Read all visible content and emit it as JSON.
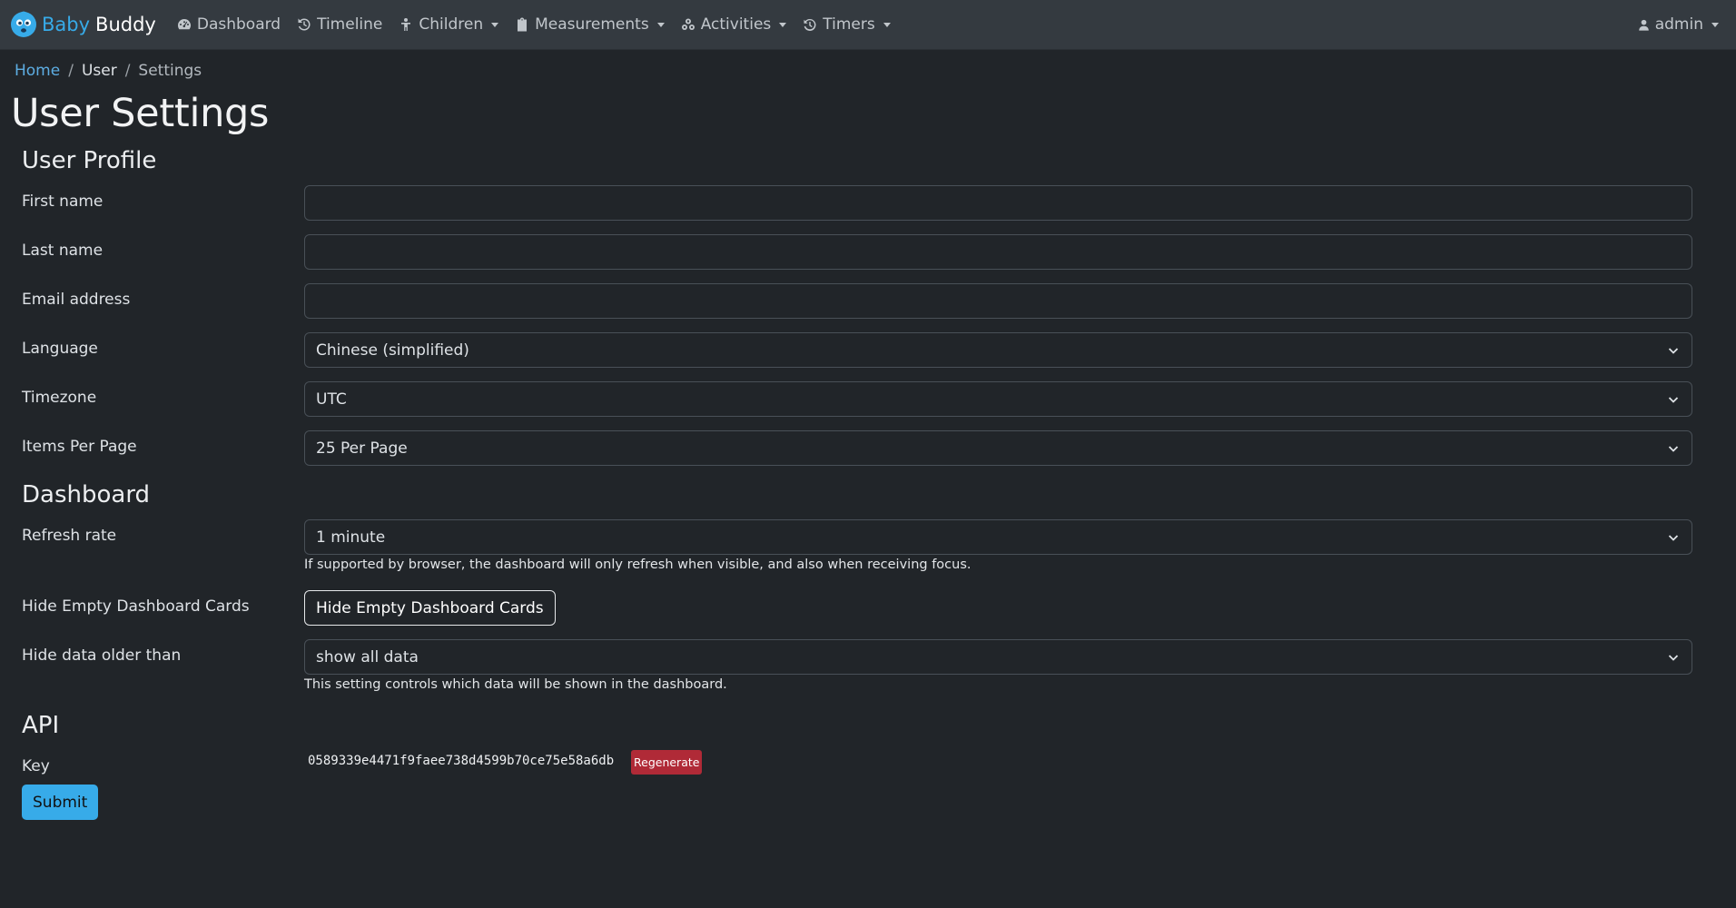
{
  "nav": {
    "brand_first": "Baby",
    "brand_second": "Buddy",
    "items": [
      {
        "label": "Dashboard",
        "icon": "dashboard-icon"
      },
      {
        "label": "Timeline",
        "icon": "history-icon"
      },
      {
        "label": "Children",
        "icon": "child-icon",
        "dropdown": true
      },
      {
        "label": "Measurements",
        "icon": "clipboard-icon",
        "dropdown": true
      },
      {
        "label": "Activities",
        "icon": "activities-icon",
        "dropdown": true
      },
      {
        "label": "Timers",
        "icon": "timer-icon",
        "dropdown": true
      }
    ],
    "user": {
      "label": "admin",
      "icon": "user-icon"
    }
  },
  "breadcrumb": {
    "home": "Home",
    "user": "User",
    "current": "Settings"
  },
  "page_title": "User Settings",
  "profile": {
    "title": "User Profile",
    "first_name_label": "First name",
    "first_name_value": "",
    "last_name_label": "Last name",
    "last_name_value": "",
    "email_label": "Email address",
    "email_value": "",
    "language_label": "Language",
    "language_value": "Chinese (simplified)",
    "timezone_label": "Timezone",
    "timezone_value": "UTC",
    "items_per_page_label": "Items Per Page",
    "items_per_page_value": "25 Per Page"
  },
  "dashboard": {
    "title": "Dashboard",
    "refresh_label": "Refresh rate",
    "refresh_value": "1 minute",
    "refresh_help": "If supported by browser, the dashboard will only refresh when visible, and also when receiving focus.",
    "hide_empty_label": "Hide Empty Dashboard Cards",
    "hide_empty_button": "Hide Empty Dashboard Cards",
    "hide_older_label": "Hide data older than",
    "hide_older_value": "show all data",
    "hide_older_help": "This setting controls which data will be shown in the dashboard."
  },
  "api": {
    "title": "API",
    "key_label": "Key",
    "key_value": "0589339e4471f9faee738d4599b70ce75e58a6db",
    "regenerate_label": "Regenerate"
  },
  "submit_label": "Submit",
  "colors": {
    "background": "#212529",
    "navbar": "#343a40",
    "brand_accent": "#37abe9",
    "danger": "#b02a37",
    "primary": "#37abe9"
  }
}
